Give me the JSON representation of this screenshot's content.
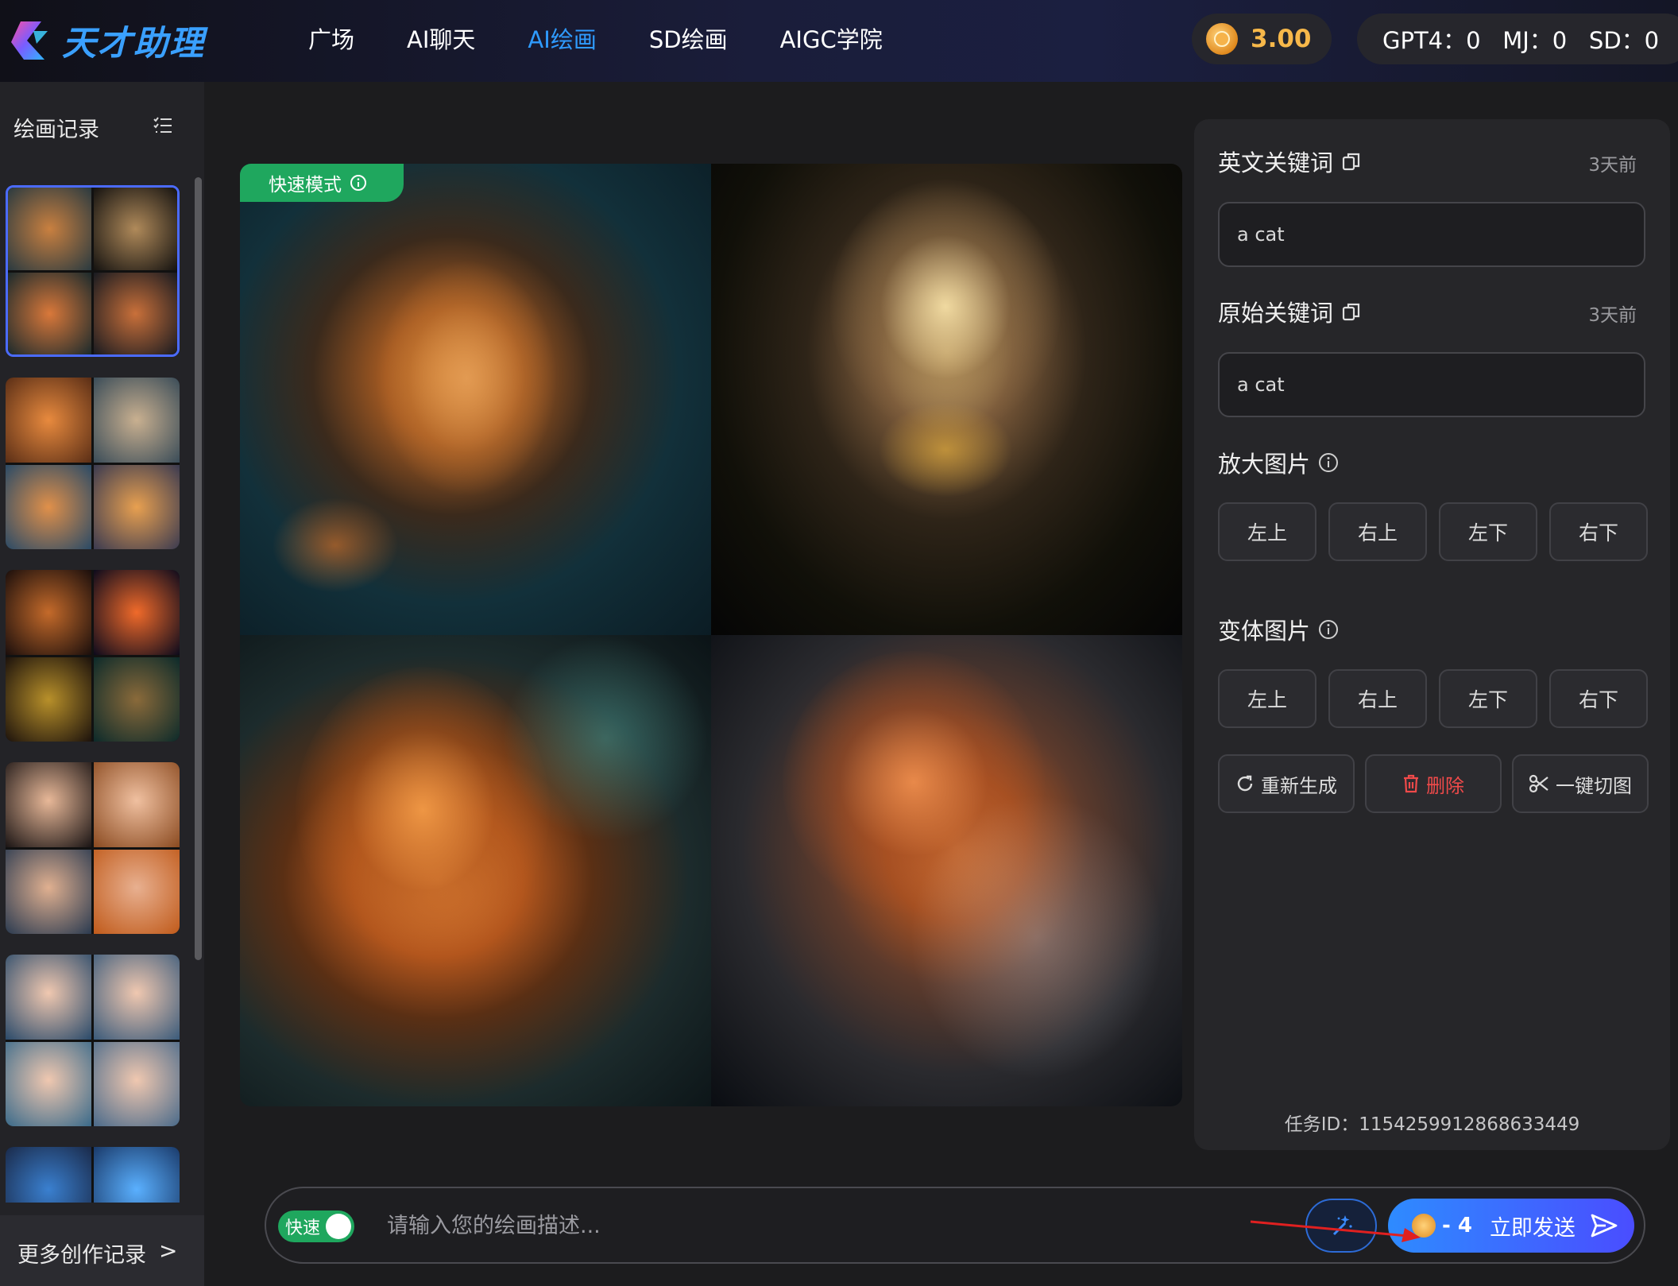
{
  "header": {
    "logo_text": "天才助理",
    "nav": [
      "广场",
      "AI聊天",
      "AI绘画",
      "SD绘画",
      "AIGC学院"
    ],
    "active_nav": "AI绘画",
    "balance": "3.00",
    "quota_text": "GPT4：0   MJ：0   SD：0"
  },
  "sidebar": {
    "title": "绘画记录",
    "more_label": "更多创作记录",
    "more_chevron": ">"
  },
  "main": {
    "mode_badge": "快速模式"
  },
  "panel": {
    "en_keywords": {
      "title": "英文关键词",
      "time": "3天前",
      "value": "a cat"
    },
    "orig_keywords": {
      "title": "原始关键词",
      "time": "3天前",
      "value": "a cat"
    },
    "upscale": {
      "title": "放大图片",
      "buttons": [
        "左上",
        "右上",
        "左下",
        "右下"
      ]
    },
    "variation": {
      "title": "变体图片",
      "buttons": [
        "左上",
        "右上",
        "左下",
        "右下"
      ]
    },
    "actions": {
      "regenerate": "重新生成",
      "delete": "删除",
      "cut": "一键切图"
    },
    "task_id": "任务ID：1154259912868633449"
  },
  "input": {
    "toggle_label": "快速",
    "placeholder": "请输入您的绘画描述...",
    "cost": "- 4",
    "send_label": "立即发送"
  },
  "colors": {
    "accent_blue": "#2f9bff",
    "badge_green": "#1fa75e",
    "danger_red": "#f04a4a",
    "coin_gold": "#f7b84a"
  }
}
